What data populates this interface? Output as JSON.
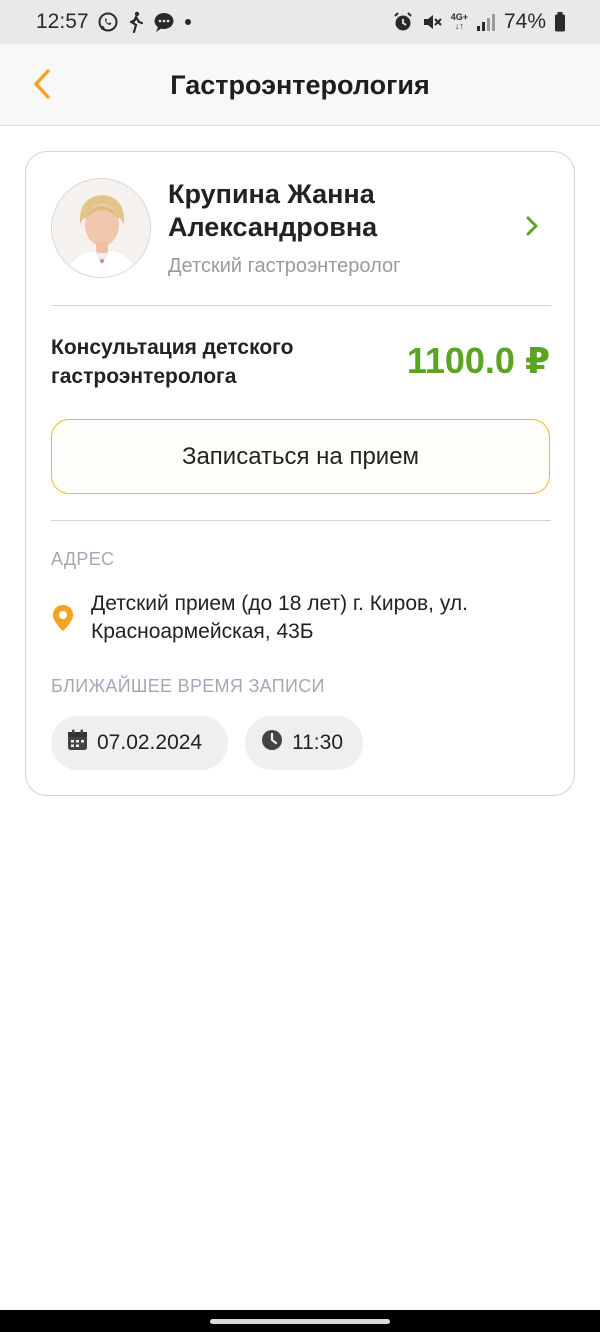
{
  "status_bar": {
    "time": "12:57",
    "battery": "74%",
    "network": "4G+",
    "left_icons": [
      "whatsapp-icon",
      "walking-icon",
      "message-icon",
      "dot-icon"
    ],
    "right_icons": [
      "alarm-icon",
      "mute-icon",
      "network-icon",
      "signal-icon",
      "battery-icon"
    ]
  },
  "header": {
    "title": "Гастроэнтерология",
    "back_icon": "chevron-left-icon"
  },
  "doctor": {
    "name": "Крупина Жанна Александровна",
    "specialty": "Детский гастроэнтеролог"
  },
  "service": {
    "name": "Консультация детского гастроэнтеролога",
    "price": "1100.0 ₽"
  },
  "book_button_label": "Записаться на прием",
  "address": {
    "label": "АДРЕС",
    "text": "Детский прием (до 18 лет) г. Киров, ул. Красноармейская, 43Б"
  },
  "nearest": {
    "label": "БЛИЖАЙШЕЕ ВРЕМЯ ЗАПИСИ",
    "date": "07.02.2024",
    "time": "11:30"
  },
  "colors": {
    "accent": "#f2a323",
    "price_green": "#5aa51f",
    "chevron_green": "#5aa51f",
    "label_gray": "#a2a9b6"
  }
}
